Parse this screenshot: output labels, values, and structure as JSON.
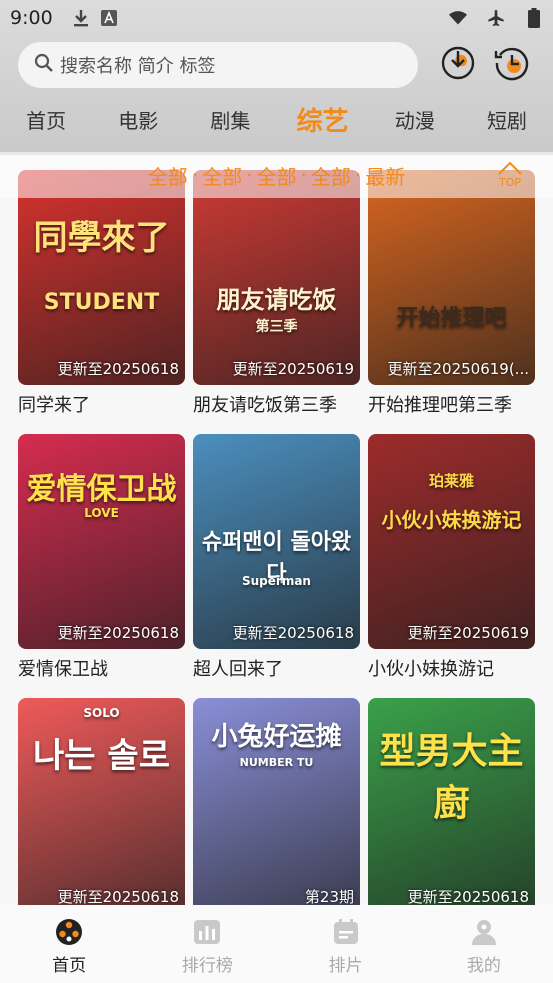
{
  "status": {
    "time": "9:00"
  },
  "search": {
    "placeholder": "搜索名称 简介 标签"
  },
  "tabs": [
    "首页",
    "电影",
    "剧集",
    "综艺",
    "动漫",
    "短剧"
  ],
  "filters": [
    "全部",
    "全部",
    "全部",
    "全部",
    "最新"
  ],
  "filter_sep": "·",
  "top_label": "TOP",
  "accent": "#f28a1d",
  "cards": [
    {
      "title": "同学来了",
      "badge": "更新至20250618",
      "poster_text": "同學來了",
      "poster_sub": "STUDENT",
      "bg": "#d9322e",
      "fg": "#ffe27a"
    },
    {
      "title": "朋友请吃饭第三季",
      "badge": "更新至20250619",
      "poster_text": "朋友请吃饭",
      "poster_sub": "第三季",
      "bg": "#cf3a34",
      "fg": "#fff3cf"
    },
    {
      "title": "开始推理吧第三季",
      "badge": "更新至20250619(...",
      "poster_text": "开始推理吧",
      "poster_sub": "",
      "bg": "#d9661f",
      "fg": "#3a2a1f"
    },
    {
      "title": "爱情保卫战",
      "badge": "更新至20250618",
      "poster_text": "爱情保卫战",
      "poster_sub": "LOVE",
      "bg": "#d62c4f",
      "fg": "#ffe14a"
    },
    {
      "title": "超人回来了",
      "badge": "更新至20250618",
      "poster_text": "슈퍼맨이 돌아왔다",
      "poster_sub": "Superman",
      "bg": "#4b8fbf",
      "fg": "#ffffff"
    },
    {
      "title": "小伙小妹换游记",
      "badge": "更新至20250619",
      "poster_text": "小伙小妹换游记",
      "poster_sub": "珀莱雅",
      "bg": "#9d2b2b",
      "fg": "#ffd84a"
    },
    {
      "title": "",
      "badge": "更新至20250618",
      "poster_text": "나는 솔로",
      "poster_sub": "SOLO",
      "bg": "#f05a5a",
      "fg": "#ffffff"
    },
    {
      "title": "",
      "badge": "第23期",
      "poster_text": "小兔好运摊",
      "poster_sub": "NUMBER TU",
      "bg": "#8a8fd8",
      "fg": "#ffffff"
    },
    {
      "title": "",
      "badge": "更新至20250618",
      "poster_text": "型男大主廚",
      "poster_sub": "",
      "bg": "#3aa14a",
      "fg": "#ffe14a"
    }
  ],
  "bottom_nav": [
    {
      "label": "首页",
      "icon": "film-reel-icon"
    },
    {
      "label": "排行榜",
      "icon": "chart-icon"
    },
    {
      "label": "排片",
      "icon": "calendar-icon"
    },
    {
      "label": "我的",
      "icon": "user-icon"
    }
  ]
}
